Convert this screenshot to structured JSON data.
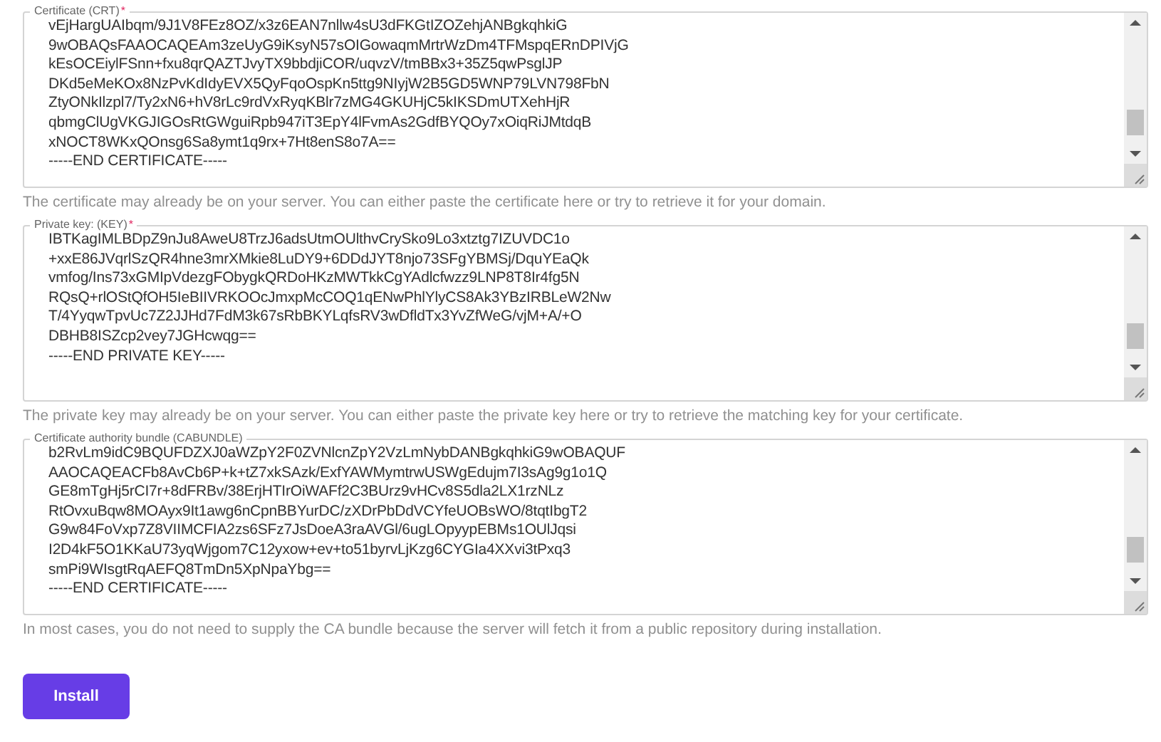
{
  "fields": [
    {
      "label": "Certificate (CRT)",
      "required_mark": "*",
      "lines": [
        "vEjHargUAIbqm/9J1V8FEz8OZ/x3z6EAN7nllw4sU3dFKGtIZOZehjANBgkqhkiG",
        "9wOBAQsFAAOCAQEAm3zeUyG9iKsyN57sOIGowaqmMrtrWzDm4TFMspqERnDPIVjG",
        "kEsOCEiylFSnn+fxu8qrQAZTJvyTX9bbdjiCOR/uqvzV/tmBBx3+35Z5qwPsglJP",
        "DKd5eMeKOx8NzPvKdIdyEVX5QyFqoOspKn5ttg9NIyjW2B5GD5WNP79LVN798FbN",
        "ZtyONkIlzpl7/Ty2xN6+hV8rLc9rdVxRyqKBlr7zMG4GKUHjC5kIKSDmUTXehHjR",
        "qbmgClUgVKGJIGOsRtGWguiRpb947iT3EpY4lFvmAs2GdfBYQOy7xOiqRiJMtdqB",
        "xNOCT8WKxQOnsg6Sa8ymt1q9rx+7Ht8enS8o7A==",
        "-----END CERTIFICATE-----"
      ],
      "help": "The certificate may already be on your server. You can either paste the certificate here or try to retrieve it for your domain."
    },
    {
      "label": "Private key: (KEY)",
      "required_mark": "*",
      "lines": [
        "IBTKagIMLBDpZ9nJu8AweU8TrzJ6adsUtmOUlthvCrySko9Lo3xtztg7IZUVDC1o",
        "+xxE86JVqrlSzQR4hne3mrXMkie8LuDY9+6DDdJYT8njo73SFgYBMSj/DquYEaQk",
        "vmfog/Ins73xGMIpVdezgFObygkQRDoHKzMWTkkCgYAdlcfwzz9LNP8T8Ir4fg5N",
        "RQsQ+rlOStQfOH5IeBIIVRKOOcJmxpMcCOQ1qENwPhlYlyCS8Ak3YBzIRBLeW2Nw",
        "T/4YyqwTpvUc7Z2JJHd7FdM3k67sRbBKYLqfsRV3wDfldTx3YvZfWeG/vjM+A/+O",
        "DBHB8ISZcp2vey7JGHcwqg==",
        "-----END PRIVATE KEY-----"
      ],
      "help": "The private key may already be on your server. You can either paste the private key here or try to retrieve the matching key for your certificate."
    },
    {
      "label": "Certificate authority bundle (CABUNDLE)",
      "lines": [
        "b2RvLm9idC9BQUFDZXJ0aWZpY2F0ZVNlcnZpY2VzLmNybDANBgkqhkiG9wOBAQUF",
        "AAOCAQEACFb8AvCb6P+k+tZ7xkSAzk/ExfYAWMymtrwUSWgEdujm7I3sAg9g1o1Q",
        "GE8mTgHj5rCI7r+8dFRBv/38ErjHTIrOiWAFf2C3BUrz9vHCv8S5dla2LX1rzNLz",
        "RtOvxuBqw8MOAyx9It1awg6nCpnBBYurDC/zXDrPbDdVCYfeUOBsWO/8tqtIbgT2",
        "G9w84FoVxp7Z8VIIMCFIA2zs6SFz7JsDoeA3raAVGl/6ugLOpyypEBMs1OUlJqsi",
        "I2D4kF5O1KKaU73yqWjgom7C12yxow+ev+to51byrvLjKzg6CYGIa4XXvi3tPxq3",
        "smPi9WIsgtRqAEFQ8TmDn5XpNpaYbg==",
        "-----END CERTIFICATE-----"
      ],
      "help": "In most cases, you do not need to supply the CA bundle because the server will fetch it from a public repository during installation."
    }
  ],
  "button": {
    "label": "Install"
  }
}
